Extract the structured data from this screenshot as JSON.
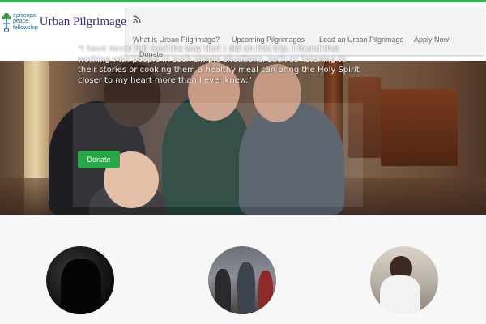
{
  "brand": {
    "org_line1": "episcopal",
    "org_line2": "peace",
    "org_line3": "fellowship",
    "site_title": "Urban Pilgrimage",
    "logo_icon": "tree-cross-icon"
  },
  "nav": {
    "rss_icon": "rss-icon",
    "items": [
      {
        "label": "What is Urban Pilgrimage?"
      },
      {
        "label": "Upcoming Pilgrimages"
      },
      {
        "label": "Lead an Urban Pilgrimage"
      },
      {
        "label": "Apply Now!"
      },
      {
        "label": "Donate"
      }
    ]
  },
  "hero": {
    "quote": "\"I have never felt God the way that I did on this trip. I found that working with people in such simple situations, such as listening to their stories or cooking them a healthy meal can bring the Holy Spirit closer to my heart more than I ever knew.\"",
    "donate_label": "Donate"
  },
  "colors": {
    "accent_green": "#2db84d",
    "button_green": "#27a745",
    "title_purple": "#3a2a8a"
  }
}
